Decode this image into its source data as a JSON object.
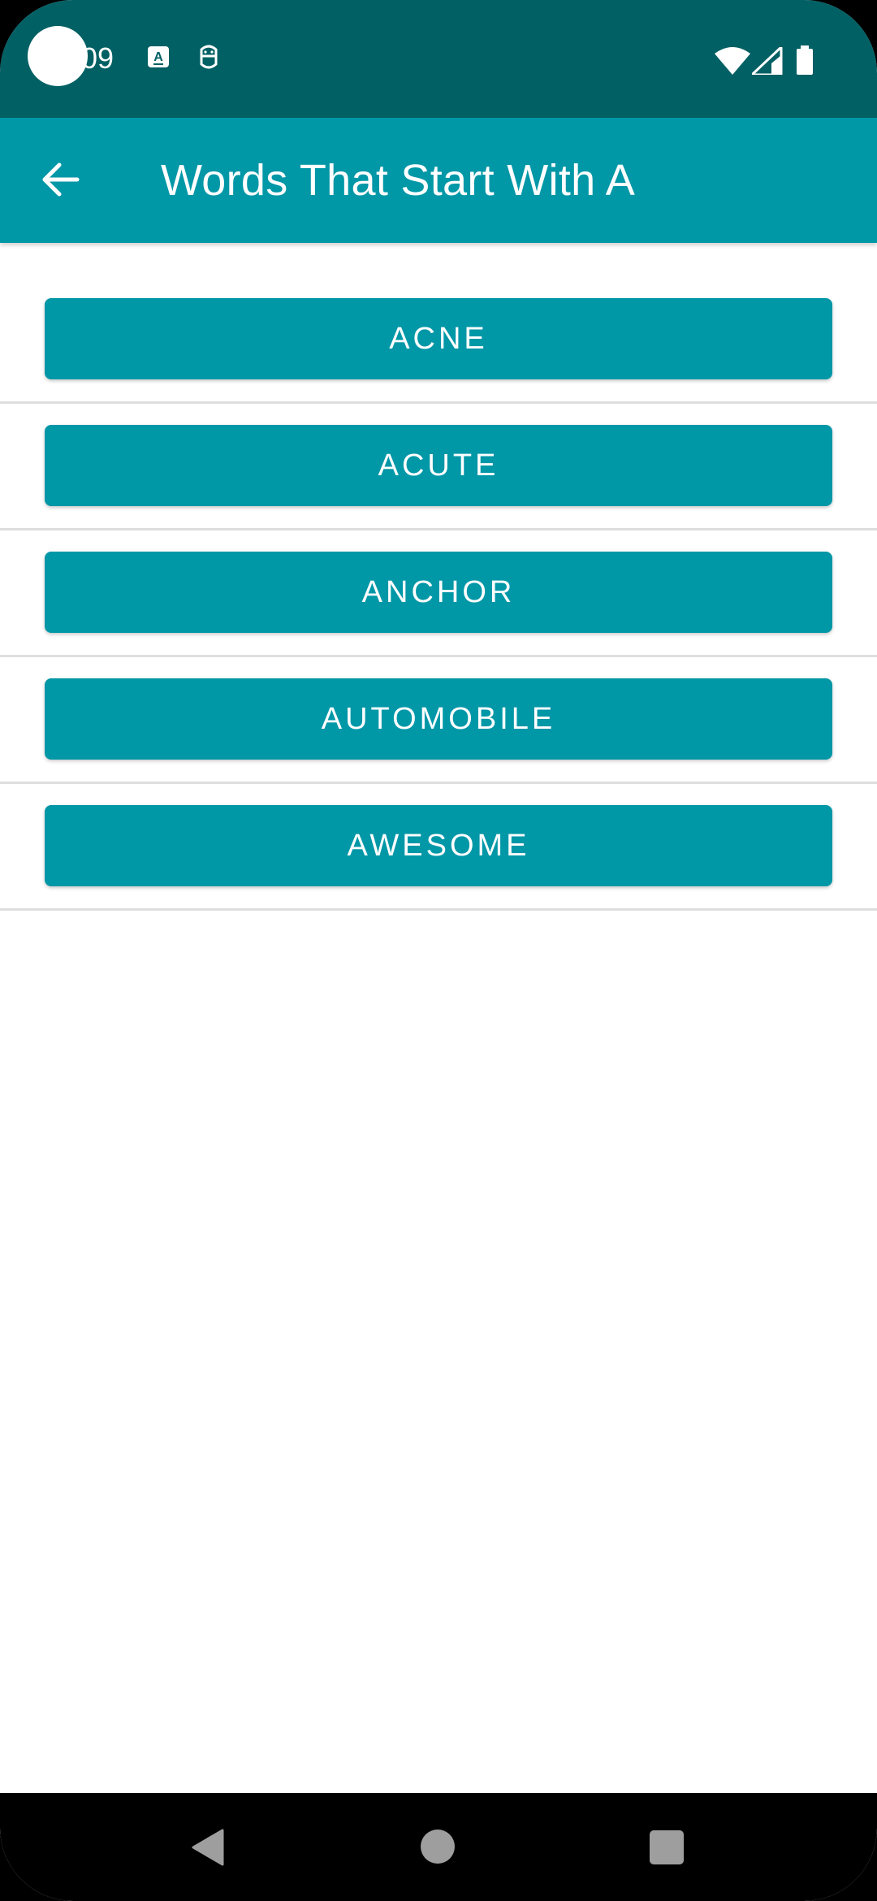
{
  "status_bar": {
    "time": "09",
    "icons": [
      "text-a-icon",
      "face-icon",
      "wifi-icon",
      "signal-icon",
      "battery-icon"
    ]
  },
  "app_bar": {
    "title": "Words That Start With A",
    "back_icon": "arrow-left-icon"
  },
  "words": [
    {
      "label": "ACNE"
    },
    {
      "label": "ACUTE"
    },
    {
      "label": "ANCHOR"
    },
    {
      "label": "AUTOMOBILE"
    },
    {
      "label": "AWESOME"
    }
  ],
  "nav_bar": {
    "icons": [
      "triangle-back-icon",
      "circle-home-icon",
      "square-recents-icon"
    ]
  },
  "colors": {
    "status_bar": "#006064",
    "primary": "#0097a7",
    "text_on_primary": "#ffffff",
    "divider": "#dedede"
  }
}
